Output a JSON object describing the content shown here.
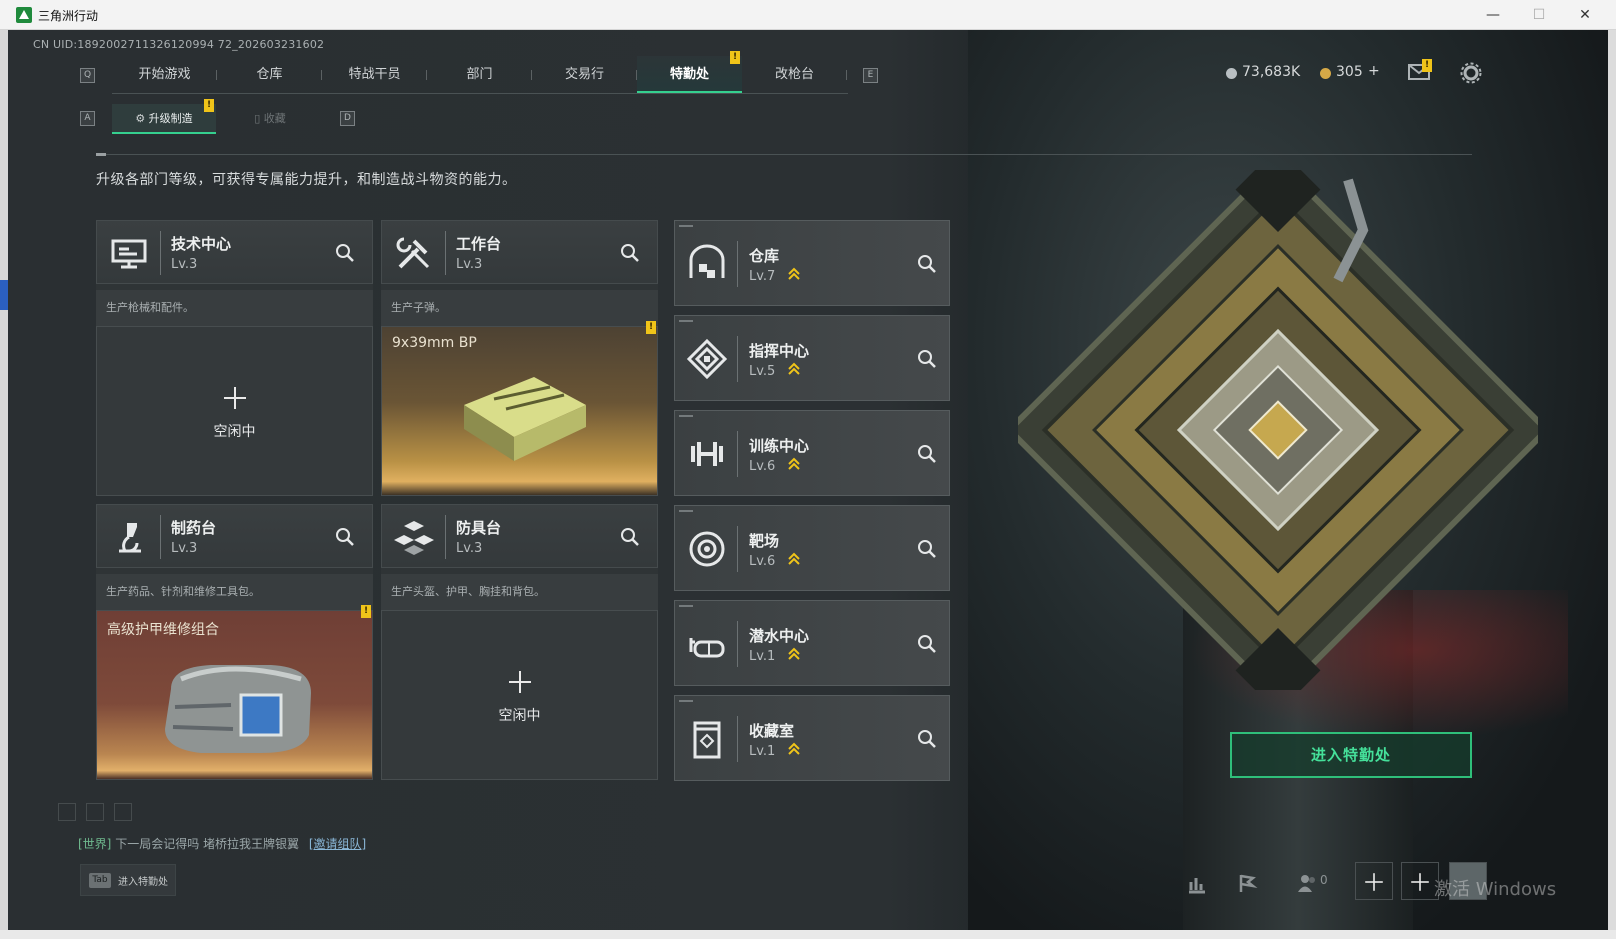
{
  "window": {
    "title": "三角洲行动",
    "minimize": "—",
    "maximize": "☐",
    "close": "✕"
  },
  "uid": "CN UID:1892002711326120994 72_202603231602",
  "nav": {
    "left_key": "Q",
    "right_key": "E",
    "tabs": [
      "开始游戏",
      "仓库",
      "特战干员",
      "部门",
      "交易行",
      "特勤处",
      "改枪台"
    ],
    "active": "特勤处",
    "badge": "!"
  },
  "currency": {
    "coins": "73,683K",
    "tickets": "305",
    "plus": "+"
  },
  "mail_badge": "!",
  "subtabs": {
    "left_key": "A",
    "right_key": "D",
    "upgrade": "升级制造",
    "collect": "收藏",
    "badge": "!"
  },
  "subtitle": "升级各部门等级，可获得专属能力提升，和制造战斗物资的能力。",
  "stations": [
    {
      "name": "技术中心",
      "level": "Lv.3",
      "desc": "生产枪械和配件。",
      "state": "空闲中"
    },
    {
      "name": "工作台",
      "level": "Lv.3",
      "desc": "生产子弹。",
      "item": "9x39mm BP",
      "badge": "!"
    },
    {
      "name": "制药台",
      "level": "Lv.3",
      "desc": "生产药品、针剂和维修工具包。",
      "item": "高级护甲维修组合",
      "badge": "!"
    },
    {
      "name": "防具台",
      "level": "Lv.3",
      "desc": "生产头盔、护甲、胸挂和背包。",
      "state": "空闲中"
    }
  ],
  "facilities": [
    {
      "name": "仓库",
      "level": "Lv.7"
    },
    {
      "name": "指挥中心",
      "level": "Lv.5"
    },
    {
      "name": "训练中心",
      "level": "Lv.6"
    },
    {
      "name": "靶场",
      "level": "Lv.6"
    },
    {
      "name": "潜水中心",
      "level": "Lv.1"
    },
    {
      "name": "收藏室",
      "level": "Lv.1"
    }
  ],
  "enter_button": "进入特勤处",
  "chat": {
    "channel": "[世界]",
    "message": "下一局会记得吗  堵桥拉我王牌银翼",
    "invite": "[邀请组队]"
  },
  "tab_hint": {
    "key": "Tab",
    "label": "进入特勤处"
  },
  "friends_count": "0",
  "watermark": "激活 Windows",
  "colors": {
    "accent": "#35d08f",
    "badge": "#f0c419",
    "upgrade": "#f0c419"
  }
}
